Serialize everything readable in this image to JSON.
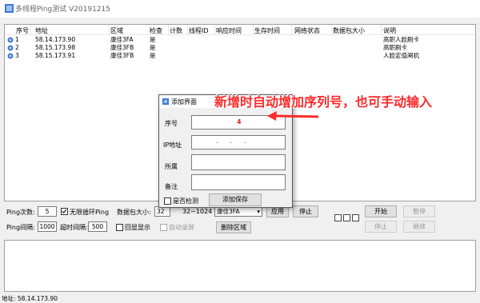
{
  "window": {
    "title": "多线程Ping测试 V20191215"
  },
  "table": {
    "columns": [
      "序号",
      "地址",
      "区域",
      "检查",
      "计数",
      "线程ID",
      "响应时间",
      "生存时间",
      "网络状态",
      "数据包大小",
      "说明"
    ],
    "rows": [
      {
        "no": "1",
        "addr": "58.14.173.90",
        "area": "康佳3FA",
        "check": "是",
        "note": "高职人脸刷卡"
      },
      {
        "no": "2",
        "addr": "58.15.173.98",
        "area": "康佳3FB",
        "check": "是",
        "note": "高职刷卡"
      },
      {
        "no": "3",
        "addr": "58.15.173.91",
        "area": "康佳3FB",
        "check": "是",
        "note": "人脸定值闸机"
      }
    ]
  },
  "controls": {
    "ping_count_label": "Ping次数:",
    "ping_count_value": "5",
    "infinite_loop_label": "无限循环Ping",
    "packet_size_label": "数据包大小:",
    "packet_size_value": "32",
    "packet_range": "32~1024",
    "area_select_value": "康佳3FA",
    "apply_label": "应用",
    "stop_label": "停止",
    "start_label": "开始",
    "pause_label": "暂停",
    "halt_label": "停止",
    "continue_label": "继续",
    "interval_label": "Ping间隔:",
    "interval_value": "1000",
    "timeout_label": "超时间隔:",
    "timeout_value": "500",
    "echo_label": "回显显示",
    "auto_record_label": "自动录屏",
    "delete_area_label": "删除区域"
  },
  "dialog": {
    "title": "添加界面",
    "serial_label": "序号",
    "serial_value": "4",
    "ip_label": "IP地址",
    "ip_value": ".       .       .",
    "area_label": "所属",
    "note_label": "备注",
    "detect_label": "是否检测",
    "save_label": "添加保存"
  },
  "annotation": {
    "text": "新增时自动增加序列号，也可手动输入"
  },
  "status": {
    "text": "地址: 58.14.173.90"
  },
  "colors": {
    "annotation": "#ff2a2a",
    "row_icon": "#3b7bd4"
  }
}
